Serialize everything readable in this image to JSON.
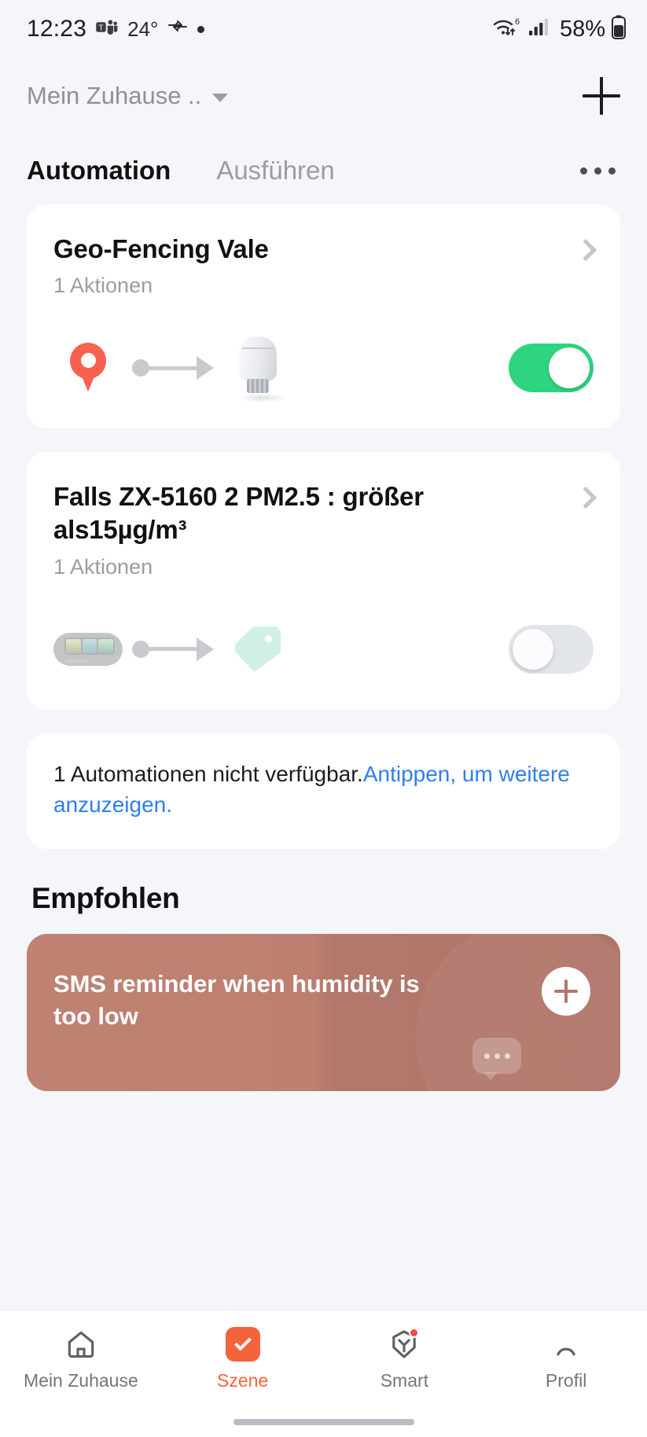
{
  "statusbar": {
    "time": "12:23",
    "teams_icon": "microsoft-teams-icon",
    "temperature": "24°",
    "arrows_icon": "data-transfer-arrows-icon",
    "dot_icon": "notification-dot-icon",
    "wifi_icon": "wifi-6-icon",
    "signal_icon": "cellular-signal-icon",
    "battery_percent": "58%",
    "battery_icon": "battery-icon"
  },
  "appbar": {
    "home_name": "Mein Zuhause ..",
    "caret_icon": "chevron-down-icon",
    "add_icon": "plus-icon"
  },
  "tabs": {
    "items": [
      {
        "label": "Automation",
        "active": true
      },
      {
        "label": "Ausführen",
        "active": false
      }
    ],
    "overflow_icon": "kebab-menu-icon"
  },
  "automations": [
    {
      "title": "Geo-Fencing Vale",
      "subtitle": "1 Aktionen",
      "chevron_icon": "chevron-right-icon",
      "trigger_icon": "location-pin-icon",
      "connector_icon": "arrow-right-connector-icon",
      "action_icon": "thermostat-valve-icon",
      "enabled": true,
      "toggle_color": "#2ed47f"
    },
    {
      "title": "Falls ZX-5160 2 PM2.5 : größer als15µg/m³",
      "subtitle": "1 Aktionen",
      "chevron_icon": "chevron-right-icon",
      "trigger_icon": "air-quality-monitor-icon",
      "connector_icon": "arrow-right-connector-icon",
      "action_icon": "tag-icon",
      "enabled": false,
      "toggle_color": "#e2e5e9"
    }
  ],
  "notice": {
    "text": "1 Automationen nicht verfügbar.",
    "link": "Antippen, um weitere anzuzeigen.",
    "link_color": "#2f7ef0"
  },
  "recommended": {
    "heading": "Empfohlen",
    "card": {
      "title": "SMS reminder when humidity is too low",
      "add_icon": "plus-circle-icon",
      "decoration_icon": "speech-bubble-icon",
      "background_color": "#bd8070"
    }
  },
  "bottomnav": {
    "items": [
      {
        "label": "Mein Zuhause",
        "icon": "home-icon",
        "active": false,
        "badge": false
      },
      {
        "label": "Szene",
        "icon": "scene-checkbox-icon",
        "active": true,
        "badge": false
      },
      {
        "label": "Smart",
        "icon": "smart-shield-icon",
        "active": false,
        "badge": true
      },
      {
        "label": "Profil",
        "icon": "profile-person-icon",
        "active": false,
        "badge": false
      }
    ],
    "active_color": "#f4633a"
  },
  "gesturebar": {
    "icon": "home-gesture-bar"
  }
}
